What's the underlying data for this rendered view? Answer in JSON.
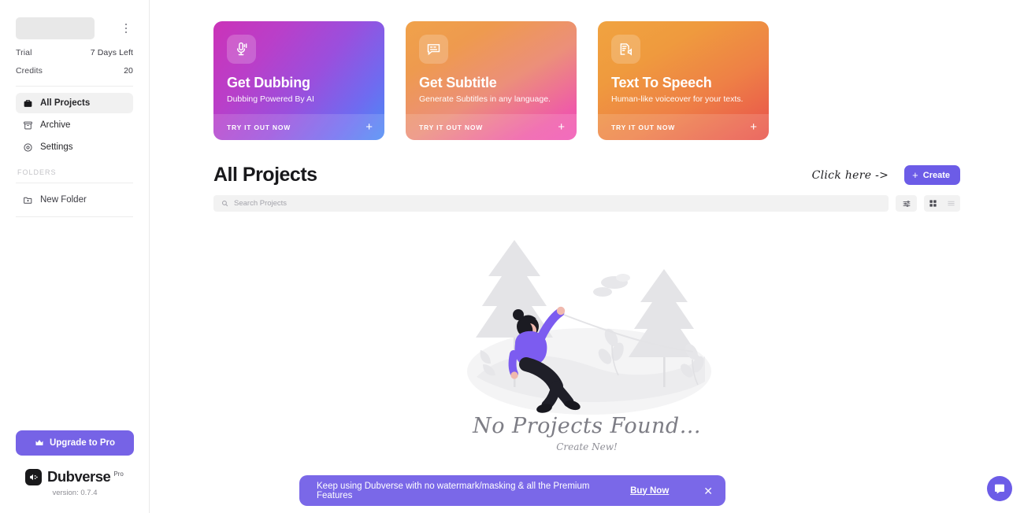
{
  "sidebar": {
    "account": {
      "skeleton": "",
      "menu_icon": "kebab-menu-icon"
    },
    "meta": [
      {
        "label": "Trial",
        "value": "7 Days Left"
      },
      {
        "label": "Credits",
        "value": "20"
      }
    ],
    "nav": [
      {
        "label": "All Projects",
        "icon": "briefcase-icon",
        "active": true
      },
      {
        "label": "Archive",
        "icon": "archive-icon",
        "active": false
      },
      {
        "label": "Settings",
        "icon": "gear-icon",
        "active": false
      }
    ],
    "folders_label": "FOLDERS",
    "new_folder": {
      "label": "New Folder",
      "icon": "folder-plus-icon"
    },
    "upgrade": {
      "label": "Upgrade to Pro",
      "icon": "crown-icon",
      "color": "#7663e6"
    },
    "brand": {
      "name": "Dubverse",
      "sup": "Pro",
      "version": "version: 0.7.4"
    }
  },
  "cards": [
    {
      "title": "Get Dubbing",
      "subtitle": "Dubbing Powered By AI",
      "cta": "TRY IT OUT NOW",
      "icon": "microphone-icon",
      "theme": "dub"
    },
    {
      "title": "Get Subtitle",
      "subtitle": "Generate Subtitles in any language.",
      "cta": "TRY IT OUT NOW",
      "icon": "closed-caption-icon",
      "theme": "sub"
    },
    {
      "title": "Text To Speech",
      "subtitle": "Human-like voiceover for your texts.",
      "cta": "TRY IT OUT NOW",
      "icon": "document-speaker-icon",
      "theme": "tts"
    }
  ],
  "projects": {
    "title": "All Projects",
    "annotation": "Click here ->",
    "create_label": "Create",
    "create_color": "#6c5ce7",
    "search_placeholder": "Search Projects",
    "search_value": "",
    "filter_icon": "sliders-icon",
    "grid_view_icon": "grid-view-icon",
    "list_view_icon": "list-view-icon",
    "active_view": "grid"
  },
  "empty_state": {
    "title": "No Projects Found...",
    "subtitle": "Create New!",
    "illustration": "person-on-swing-illustration"
  },
  "banner": {
    "text": "Keep using Dubverse with no watermark/masking & all the Premium Features",
    "link": "Buy Now",
    "close_icon": "close-icon",
    "color": "#7a68e8"
  },
  "chat": {
    "icon": "chat-bubble-icon",
    "color": "#6c5ce7"
  }
}
